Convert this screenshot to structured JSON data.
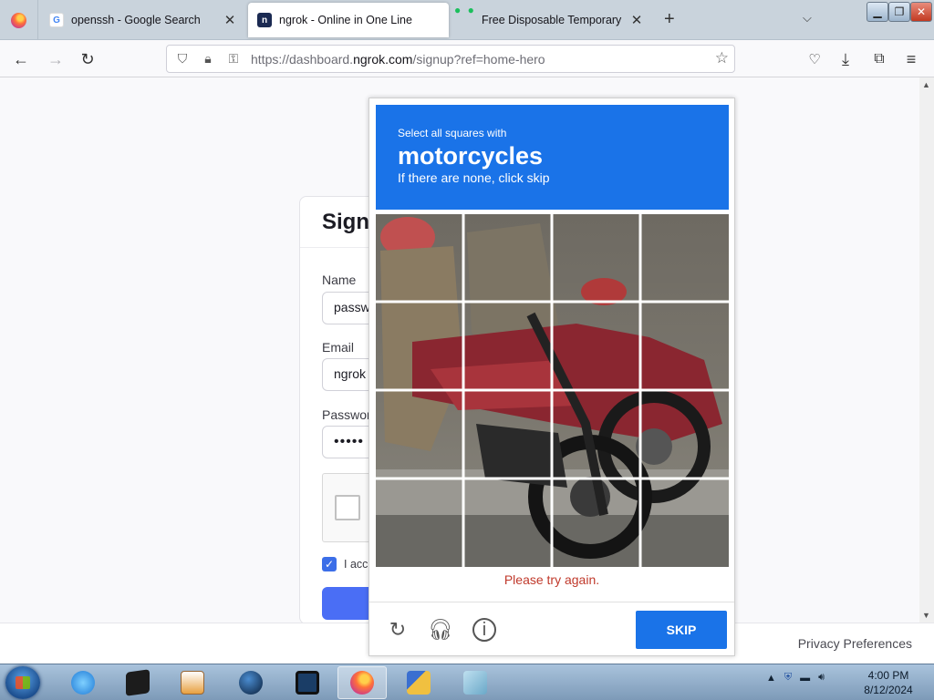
{
  "browser": {
    "tabs": [
      {
        "title": "openssh - Google Search",
        "favicon": "G"
      },
      {
        "title": "ngrok - Online in One Line",
        "favicon": "n"
      },
      {
        "title": "Free Disposable Temporary & F",
        "favicon": ""
      }
    ],
    "url_prefix": "https://dashboard.",
    "url_domain": "ngrok.com",
    "url_path": "/signup?ref=home-hero"
  },
  "signup": {
    "heading": "Sign",
    "name_label": "Name",
    "name_value": "passw",
    "email_label": "Email",
    "email_value": "ngrok",
    "password_label": "Passwor",
    "password_value": "•••••",
    "agree_text": "I acc",
    "privacy_link": "Privacy Preferences"
  },
  "captcha": {
    "instruction": "Select all squares with",
    "target": "motorcycles",
    "hint": "If there are none, click skip",
    "error": "Please try again.",
    "skip_label": "SKIP"
  },
  "taskbar": {
    "time": "4:00 PM",
    "date": "8/12/2024"
  },
  "colors": {
    "captcha_blue": "#1a73e8",
    "error_red": "#c0392b",
    "signup_accent": "#4a6ef5"
  }
}
